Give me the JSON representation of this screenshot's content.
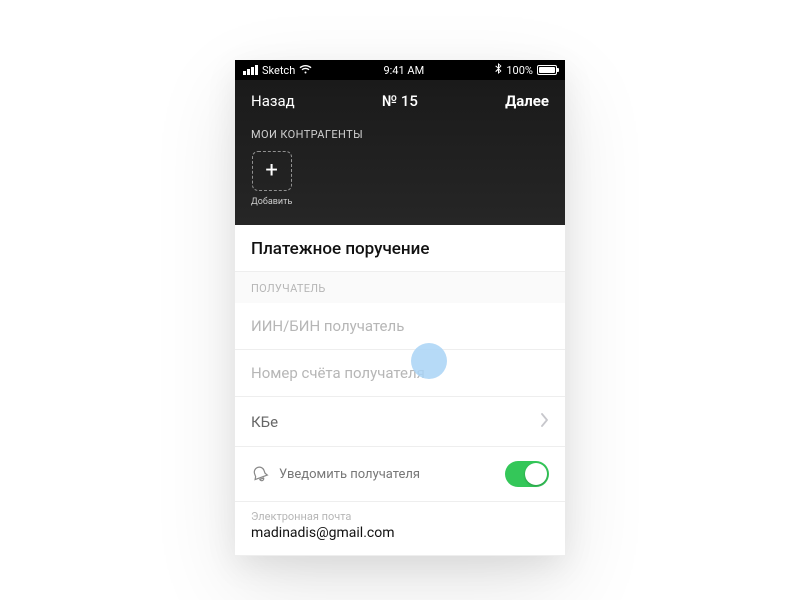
{
  "status": {
    "carrier": "Sketch",
    "time": "9:41 AM",
    "battery_pct": "100%"
  },
  "nav": {
    "back": "Назад",
    "title": "№ 15",
    "next": "Далее"
  },
  "contr": {
    "section_label": "МОИ КОНТРАГЕНТЫ",
    "add_label": "Добавить"
  },
  "form": {
    "title": "Платежное поручение",
    "recipient_section": "ПОЛУЧАТЕЛЬ",
    "iin_placeholder": "ИИН/БИН получатель",
    "account_placeholder": "Номер счёта получателя",
    "kbe_label": "КБе",
    "notify_label": "Уведомить получателя",
    "notify_on": true,
    "email_caption": "Электронная почта",
    "email_value": "madinadis@gmail.com"
  },
  "colors": {
    "switch_on": "#34c759"
  }
}
